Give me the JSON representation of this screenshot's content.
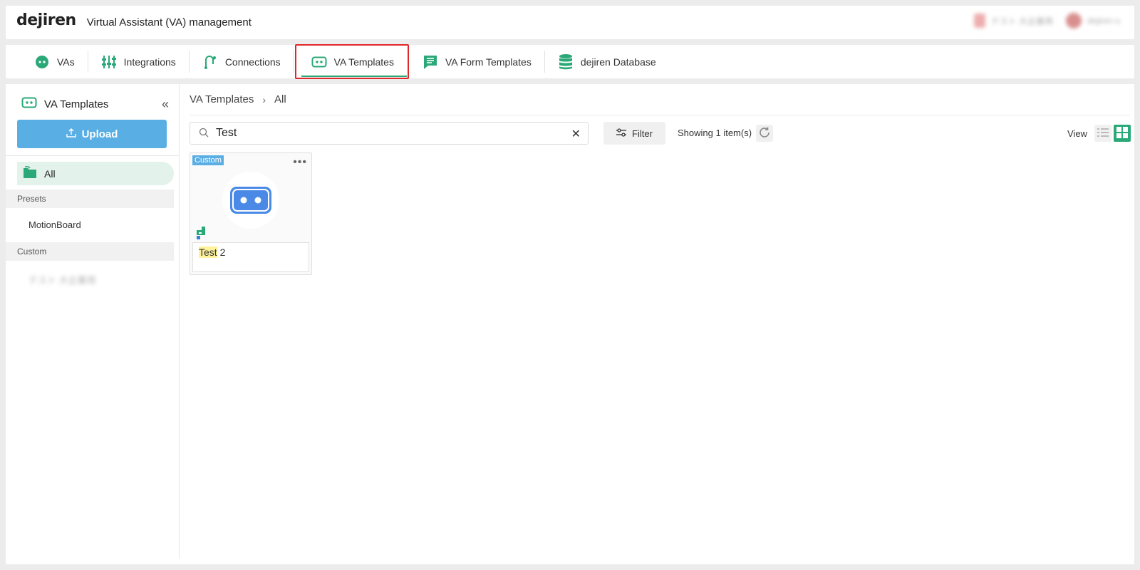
{
  "header": {
    "logo": "dejiren",
    "title": "Virtual Assistant (VA) management",
    "account_blurred": "テスト 大企業用",
    "user_blurred": "dejiren u"
  },
  "tabs": [
    {
      "label": "VAs",
      "icon": "va-face-icon"
    },
    {
      "label": "Integrations",
      "icon": "sliders-icon"
    },
    {
      "label": "Connections",
      "icon": "connection-icon"
    },
    {
      "label": "VA Templates",
      "icon": "template-icon",
      "active": true
    },
    {
      "label": "VA Form Templates",
      "icon": "form-icon"
    },
    {
      "label": "dejiren Database",
      "icon": "database-icon"
    }
  ],
  "sidebar": {
    "title": "VA Templates",
    "upload_label": "Upload",
    "all_label": "All",
    "presets_section": "Presets",
    "presets_items": [
      "MotionBoard"
    ],
    "custom_section": "Custom",
    "custom_items_blurred": [
      "テスト 大企業用"
    ]
  },
  "content": {
    "breadcrumb": [
      "VA Templates",
      "All"
    ],
    "search_value": "Test",
    "filter_label": "Filter",
    "showing_text": "Showing 1 item(s)",
    "view_label": "View"
  },
  "card": {
    "badge": "Custom",
    "name_highlight": "Test",
    "name_rest": " 2"
  },
  "colors": {
    "accent_green": "#2aa877",
    "upload_blue": "#59aee3",
    "active_outline": "#e0262b",
    "template_blue": "#4a8ae6"
  }
}
